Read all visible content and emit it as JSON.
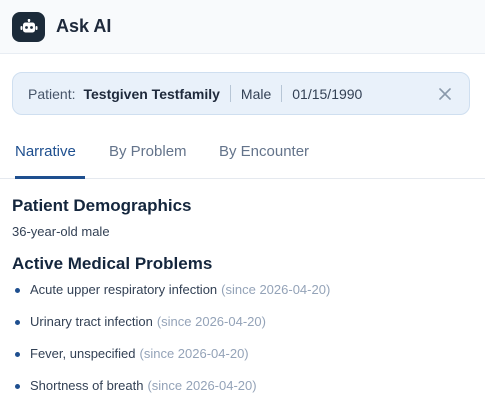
{
  "header": {
    "title": "Ask AI",
    "icon": "robot-icon",
    "icon_bg": "#1c2b3a"
  },
  "patient": {
    "label": "Patient:",
    "name": "Testgiven Testfamily",
    "sex": "Male",
    "dob": "01/15/1990",
    "close_icon": "close-icon"
  },
  "tabs": [
    {
      "label": "Narrative",
      "active": true
    },
    {
      "label": "By Problem",
      "active": false
    },
    {
      "label": "By Encounter",
      "active": false
    }
  ],
  "demographics": {
    "title": "Patient Demographics",
    "text": "36-year-old male"
  },
  "problems": {
    "title": "Active Medical Problems",
    "items": [
      {
        "name": "Acute upper respiratory infection",
        "since": "(since 2026-04-20)"
      },
      {
        "name": "Urinary tract infection",
        "since": "(since 2026-04-20)"
      },
      {
        "name": "Fever, unspecified",
        "since": "(since 2026-04-20)"
      },
      {
        "name": "Shortness of breath",
        "since": "(since 2026-04-20)"
      }
    ]
  },
  "colors": {
    "accent": "#1e4f8f",
    "patient_bar_bg": "#e9f1fa"
  }
}
